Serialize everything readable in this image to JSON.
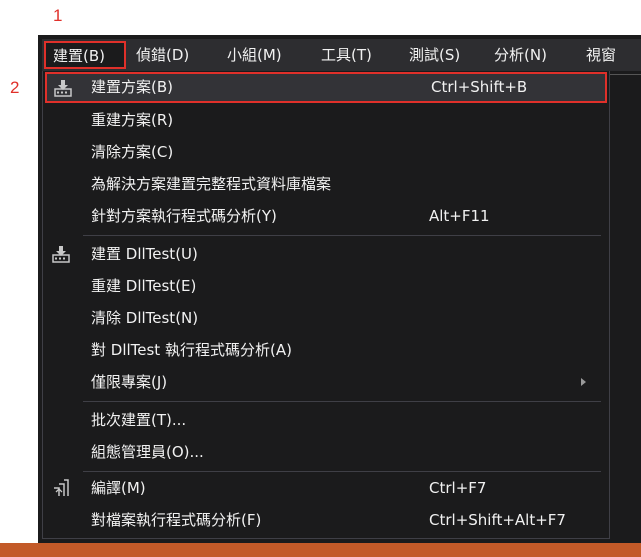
{
  "callouts": {
    "one": "1",
    "two": "2"
  },
  "menubar": {
    "build": "建置(B)",
    "debug": "偵錯(D)",
    "team": "小組(M)",
    "tools": "工具(T)",
    "test": "測試(S)",
    "analyze": "分析(N)",
    "view": "視窗"
  },
  "menu": {
    "items": [
      {
        "label": "建置方案(B)",
        "shortcut": "Ctrl+Shift+B",
        "icon": "build-icon"
      },
      {
        "label": "重建方案(R)"
      },
      {
        "label": "清除方案(C)"
      },
      {
        "label": "為解決方案建置完整程式資料庫檔案"
      },
      {
        "label": "針對方案執行程式碼分析(Y)",
        "shortcut": "Alt+F11"
      },
      {
        "label": "建置 DllTest(U)",
        "icon": "build-icon"
      },
      {
        "label": "重建 DllTest(E)"
      },
      {
        "label": "清除 DllTest(N)"
      },
      {
        "label": "對 DllTest 執行程式碼分析(A)"
      },
      {
        "label": "僅限專案(J)",
        "submenu": true
      },
      {
        "label": "批次建置(T)..."
      },
      {
        "label": "組態管理員(O)..."
      },
      {
        "label": "編譯(M)",
        "shortcut": "Ctrl+F7",
        "icon": "compile-icon"
      },
      {
        "label": "對檔案執行程式碼分析(F)",
        "shortcut": "Ctrl+Shift+Alt+F7"
      }
    ]
  },
  "colors": {
    "highlight_border": "#e0302a",
    "menu_background": "#1b1b1c",
    "menu_text": "#f1f1f1",
    "status_bar": "#c35a28"
  }
}
